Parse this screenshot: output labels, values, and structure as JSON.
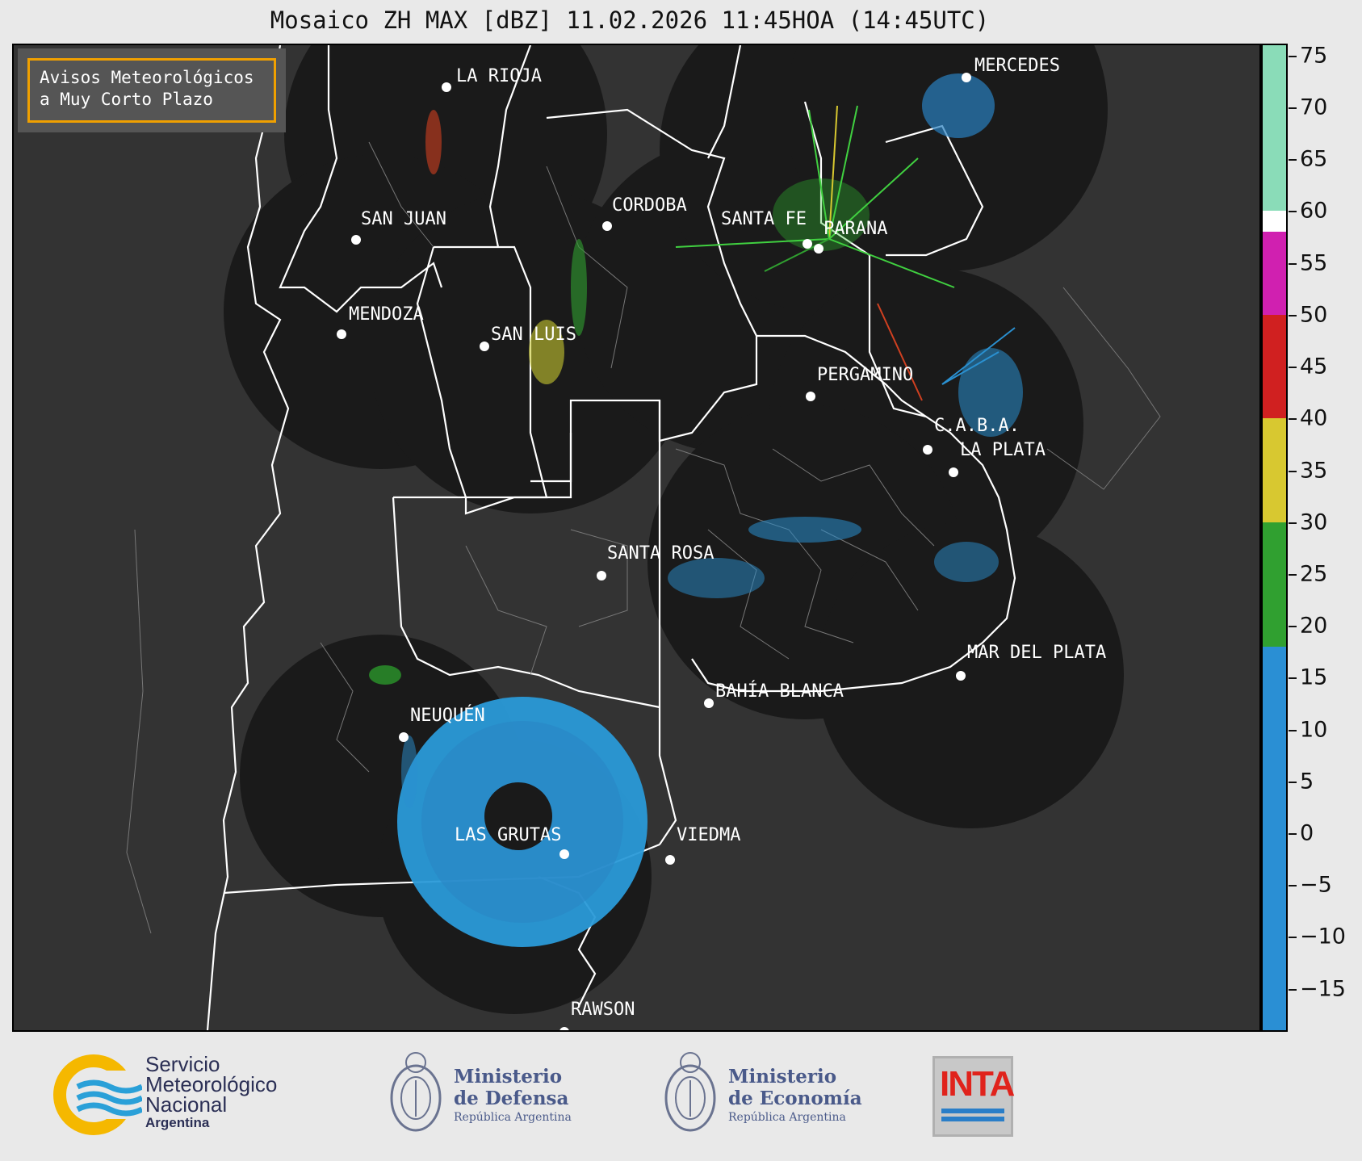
{
  "title": "Mosaico ZH MAX [dBZ] 11.02.2026 11:45HOA (14:45UTC)",
  "notice": {
    "line1": "Avisos Meteorológicos",
    "line2": "a Muy Corto Plazo"
  },
  "cities": [
    {
      "name": "LA RIOJA"
    },
    {
      "name": "MERCEDES"
    },
    {
      "name": "SAN JUAN"
    },
    {
      "name": "CORDOBA"
    },
    {
      "name": "SANTA FE"
    },
    {
      "name": "PARANA"
    },
    {
      "name": "MENDOZA"
    },
    {
      "name": "SAN LUIS"
    },
    {
      "name": "PERGAMINO"
    },
    {
      "name": "C.A.B.A."
    },
    {
      "name": "LA PLATA"
    },
    {
      "name": "SANTA ROSA"
    },
    {
      "name": "MAR DEL PLATA"
    },
    {
      "name": "BAHÍA BLANCA"
    },
    {
      "name": "NEUQUÉN"
    },
    {
      "name": "LAS GRUTAS"
    },
    {
      "name": "VIEDMA"
    },
    {
      "name": "RAWSON"
    }
  ],
  "colorbar": {
    "unit": "dBZ",
    "min": -19,
    "max": 76,
    "ticks": [
      "75",
      "70",
      "65",
      "60",
      "55",
      "50",
      "45",
      "40",
      "35",
      "30",
      "25",
      "20",
      "15",
      "10",
      "5",
      "0",
      "−5",
      "−10",
      "−15"
    ],
    "tick_values": [
      75,
      70,
      65,
      60,
      55,
      50,
      45,
      40,
      35,
      30,
      25,
      20,
      15,
      10,
      5,
      0,
      -5,
      -10,
      -15
    ],
    "bands": [
      {
        "from": -19,
        "to": 18,
        "color": "#2a8fd4"
      },
      {
        "from": 18,
        "to": 30,
        "color": "#30a030"
      },
      {
        "from": 30,
        "to": 40,
        "color": "#d8c830"
      },
      {
        "from": 40,
        "to": 50,
        "color": "#d02020"
      },
      {
        "from": 50,
        "to": 58,
        "color": "#d020b0"
      },
      {
        "from": 58,
        "to": 60,
        "color": "#ffffff"
      },
      {
        "from": 60,
        "to": 76,
        "color": "#8adcb8"
      }
    ]
  },
  "footer": {
    "smn": {
      "line1": "Servicio",
      "line2": "Meteorológico",
      "line3": "Nacional",
      "line4": "Argentina"
    },
    "defensa": {
      "line1": "Ministerio",
      "line2": "de Defensa",
      "line3": "República Argentina"
    },
    "economia": {
      "line1": "Ministerio",
      "line2": "de Economía",
      "line3": "República Argentina"
    },
    "inta": {
      "label": "INTA"
    }
  },
  "colors": {
    "map_bg": "#333333",
    "radar_disk": "#1a1a1a",
    "echo_weak": "#2a8fd4",
    "echo_mod": "#30c030",
    "notice_border": "#f0a000"
  }
}
